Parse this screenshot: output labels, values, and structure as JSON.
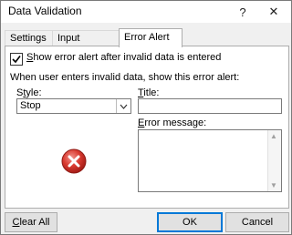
{
  "window": {
    "title": "Data Validation",
    "help_glyph": "?",
    "close_glyph": "✕"
  },
  "tabs": [
    {
      "label": "Settings",
      "active": false
    },
    {
      "label": "Input Message",
      "active": false
    },
    {
      "label": "Error Alert",
      "active": true
    }
  ],
  "error_alert": {
    "show_alert_label": "Show error alert after invalid data is entered",
    "show_alert_checked": true,
    "section_caption": "When user enters invalid data, show this error alert:",
    "style_label": "Style:",
    "style_value": "Stop",
    "title_label": "Title:",
    "title_value": "",
    "message_label": "Error message:",
    "message_value": "",
    "alert_icon": "stop-error-icon",
    "alert_icon_color": "#d32f2f"
  },
  "footer": {
    "clear_all_label": "Clear All",
    "ok_label": "OK",
    "cancel_label": "Cancel"
  }
}
